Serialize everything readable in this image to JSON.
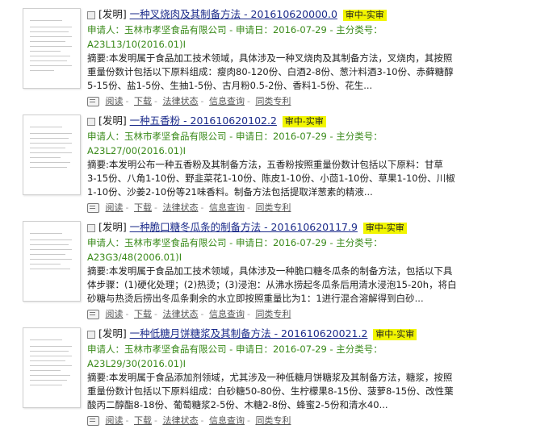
{
  "results": [
    {
      "tag": "[发明]",
      "title": "一种叉烧肉及其制备方法 - 201610620000.0",
      "status": "审中-实审",
      "meta_line1": "申请人：玉林市孝坚食品有限公司 - 申请日：2016-07-29 - 主分类号：",
      "meta_line2": "A23L13/10(2016.01)I",
      "abstract_lines": [
        "摘要:本发明属于食品加工技术领域，具体涉及一种叉烧肉及其制备方法，叉烧肉，其按照",
        "重量份数计包括以下原料组成：瘦肉80-120份、白酒2-8份、葱汁料酒3-10份、赤藓糖醇",
        "5-15份、盐1-5份、生抽1-5份、古月粉0.5-2份、香料1-5份、花生..."
      ]
    },
    {
      "tag": "[发明]",
      "title": "一种五香粉 - 201610620102.2",
      "status": "审中-实审",
      "meta_line1": "申请人：玉林市孝坚食品有限公司 - 申请日：2016-07-29 - 主分类号：",
      "meta_line2": "A23L27/00(2016.01)I",
      "abstract_lines": [
        "摘要:本发明公布一种五香粉及其制备方法，五香粉按照重量份数计包括以下原料：甘草",
        "3-15份、八角1-10份、野韭菜花1-10份、陈皮1-10份、小茴1-10份、草果1-10份、川椒",
        "1-10份、沙姜2-10份等21味香料。制备方法包括提取洋葱素的精液..."
      ]
    },
    {
      "tag": "[发明]",
      "title": "一种脆口糖冬瓜条的制备方法 - 201610620117.9",
      "status": "审中-实审",
      "meta_line1": "申请人：玉林市孝坚食品有限公司 - 申请日：2016-07-29 - 主分类号：",
      "meta_line2": "A23G3/48(2006.01)I",
      "abstract_lines": [
        "摘要:本发明属于食品加工技术领域，具体涉及一种脆口糖冬瓜条的制备方法，包括以下具",
        "体步骤：(1)硬化处理；(2)热烫；(3)浸泡：从沸水捞起冬瓜条后用清水浸泡15-20h，将白",
        "砂糖与热烫后捞出冬瓜条剩余的水立即按照重量比为1：1进行混合溶解得到白砂..."
      ]
    },
    {
      "tag": "[发明]",
      "title": "一种低糖月饼糖浆及其制备方法 - 201610620021.2",
      "status": "审中-实审",
      "meta_line1": "申请人：玉林市孝坚食品有限公司 - 申请日：2016-07-29 - 主分类号：",
      "meta_line2": "A23L29/30(2016.01)I",
      "abstract_lines": [
        "摘要:本发明属于食品添加剂领域，尤其涉及一种低糖月饼糖浆及其制备方法，糖浆，按照",
        "重量份数计包括以下原料组成：白砂糖50-80份、生柠檬果8-15份、菠萝8-15份、改性葉",
        "酸丙二醇酯8-18份、葡萄糖浆2-5份、木糖2-8份、蜂蜜2-5份和清水40..."
      ]
    }
  ],
  "action_links": [
    "阅读",
    "下载",
    "法律状态",
    "信息查询",
    "同类专利"
  ]
}
